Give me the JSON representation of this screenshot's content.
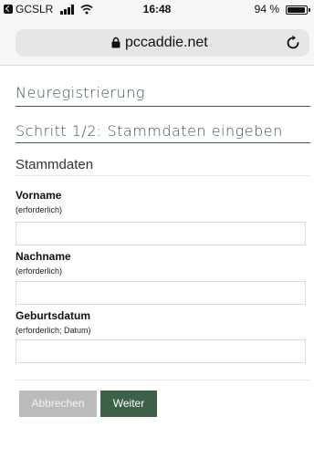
{
  "status_bar": {
    "carrier": "GCSLR",
    "time": "16:48",
    "battery_percent": "94 %"
  },
  "browser": {
    "url": "pccaddie.net"
  },
  "page": {
    "heading": "Neuregistrierung",
    "step_heading": "Schritt 1/2: Stammdaten eingeben",
    "section_heading": "Stammdaten"
  },
  "form": {
    "fields": [
      {
        "label": "Vorname",
        "hint": "(erforderlich)",
        "value": ""
      },
      {
        "label": "Nachname",
        "hint": "(erforderlich)",
        "value": ""
      },
      {
        "label": "Geburtsdatum",
        "hint": "(erforderlich; Datum)",
        "value": ""
      }
    ],
    "cancel_label": "Abbrechen",
    "next_label": "Weiter"
  },
  "colors": {
    "accent": "#3d6048",
    "disabled": "#bbbbbb"
  }
}
